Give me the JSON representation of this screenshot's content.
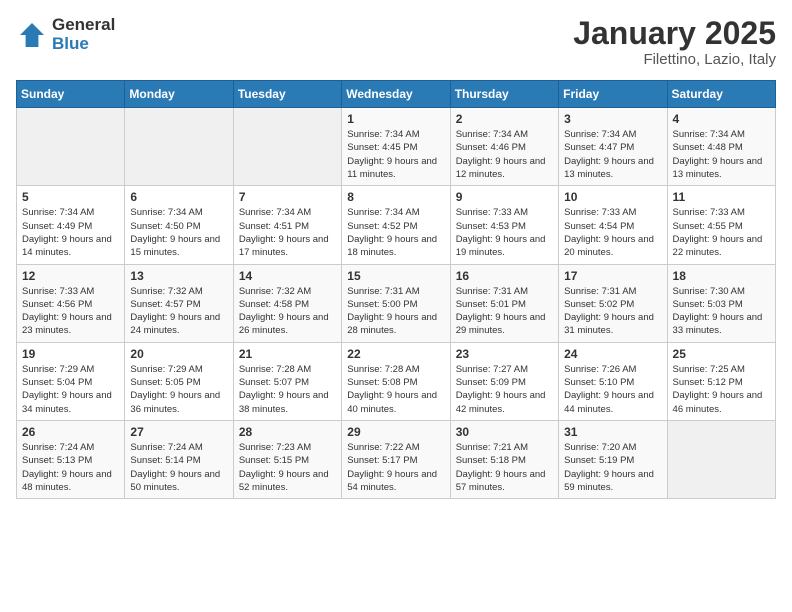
{
  "logo": {
    "general": "General",
    "blue": "Blue"
  },
  "title": "January 2025",
  "subtitle": "Filettino, Lazio, Italy",
  "weekdays": [
    "Sunday",
    "Monday",
    "Tuesday",
    "Wednesday",
    "Thursday",
    "Friday",
    "Saturday"
  ],
  "weeks": [
    [
      {
        "day": "",
        "empty": true
      },
      {
        "day": "",
        "empty": true
      },
      {
        "day": "",
        "empty": true
      },
      {
        "day": "1",
        "sunrise": "7:34 AM",
        "sunset": "4:45 PM",
        "daylight": "9 hours and 11 minutes."
      },
      {
        "day": "2",
        "sunrise": "7:34 AM",
        "sunset": "4:46 PM",
        "daylight": "9 hours and 12 minutes."
      },
      {
        "day": "3",
        "sunrise": "7:34 AM",
        "sunset": "4:47 PM",
        "daylight": "9 hours and 13 minutes."
      },
      {
        "day": "4",
        "sunrise": "7:34 AM",
        "sunset": "4:48 PM",
        "daylight": "9 hours and 13 minutes."
      }
    ],
    [
      {
        "day": "5",
        "sunrise": "7:34 AM",
        "sunset": "4:49 PM",
        "daylight": "9 hours and 14 minutes."
      },
      {
        "day": "6",
        "sunrise": "7:34 AM",
        "sunset": "4:50 PM",
        "daylight": "9 hours and 15 minutes."
      },
      {
        "day": "7",
        "sunrise": "7:34 AM",
        "sunset": "4:51 PM",
        "daylight": "9 hours and 17 minutes."
      },
      {
        "day": "8",
        "sunrise": "7:34 AM",
        "sunset": "4:52 PM",
        "daylight": "9 hours and 18 minutes."
      },
      {
        "day": "9",
        "sunrise": "7:33 AM",
        "sunset": "4:53 PM",
        "daylight": "9 hours and 19 minutes."
      },
      {
        "day": "10",
        "sunrise": "7:33 AM",
        "sunset": "4:54 PM",
        "daylight": "9 hours and 20 minutes."
      },
      {
        "day": "11",
        "sunrise": "7:33 AM",
        "sunset": "4:55 PM",
        "daylight": "9 hours and 22 minutes."
      }
    ],
    [
      {
        "day": "12",
        "sunrise": "7:33 AM",
        "sunset": "4:56 PM",
        "daylight": "9 hours and 23 minutes."
      },
      {
        "day": "13",
        "sunrise": "7:32 AM",
        "sunset": "4:57 PM",
        "daylight": "9 hours and 24 minutes."
      },
      {
        "day": "14",
        "sunrise": "7:32 AM",
        "sunset": "4:58 PM",
        "daylight": "9 hours and 26 minutes."
      },
      {
        "day": "15",
        "sunrise": "7:31 AM",
        "sunset": "5:00 PM",
        "daylight": "9 hours and 28 minutes."
      },
      {
        "day": "16",
        "sunrise": "7:31 AM",
        "sunset": "5:01 PM",
        "daylight": "9 hours and 29 minutes."
      },
      {
        "day": "17",
        "sunrise": "7:31 AM",
        "sunset": "5:02 PM",
        "daylight": "9 hours and 31 minutes."
      },
      {
        "day": "18",
        "sunrise": "7:30 AM",
        "sunset": "5:03 PM",
        "daylight": "9 hours and 33 minutes."
      }
    ],
    [
      {
        "day": "19",
        "sunrise": "7:29 AM",
        "sunset": "5:04 PM",
        "daylight": "9 hours and 34 minutes."
      },
      {
        "day": "20",
        "sunrise": "7:29 AM",
        "sunset": "5:05 PM",
        "daylight": "9 hours and 36 minutes."
      },
      {
        "day": "21",
        "sunrise": "7:28 AM",
        "sunset": "5:07 PM",
        "daylight": "9 hours and 38 minutes."
      },
      {
        "day": "22",
        "sunrise": "7:28 AM",
        "sunset": "5:08 PM",
        "daylight": "9 hours and 40 minutes."
      },
      {
        "day": "23",
        "sunrise": "7:27 AM",
        "sunset": "5:09 PM",
        "daylight": "9 hours and 42 minutes."
      },
      {
        "day": "24",
        "sunrise": "7:26 AM",
        "sunset": "5:10 PM",
        "daylight": "9 hours and 44 minutes."
      },
      {
        "day": "25",
        "sunrise": "7:25 AM",
        "sunset": "5:12 PM",
        "daylight": "9 hours and 46 minutes."
      }
    ],
    [
      {
        "day": "26",
        "sunrise": "7:24 AM",
        "sunset": "5:13 PM",
        "daylight": "9 hours and 48 minutes."
      },
      {
        "day": "27",
        "sunrise": "7:24 AM",
        "sunset": "5:14 PM",
        "daylight": "9 hours and 50 minutes."
      },
      {
        "day": "28",
        "sunrise": "7:23 AM",
        "sunset": "5:15 PM",
        "daylight": "9 hours and 52 minutes."
      },
      {
        "day": "29",
        "sunrise": "7:22 AM",
        "sunset": "5:17 PM",
        "daylight": "9 hours and 54 minutes."
      },
      {
        "day": "30",
        "sunrise": "7:21 AM",
        "sunset": "5:18 PM",
        "daylight": "9 hours and 57 minutes."
      },
      {
        "day": "31",
        "sunrise": "7:20 AM",
        "sunset": "5:19 PM",
        "daylight": "9 hours and 59 minutes."
      },
      {
        "day": "",
        "empty": true
      }
    ]
  ],
  "labels": {
    "sunrise": "Sunrise:",
    "sunset": "Sunset:",
    "daylight": "Daylight:"
  }
}
